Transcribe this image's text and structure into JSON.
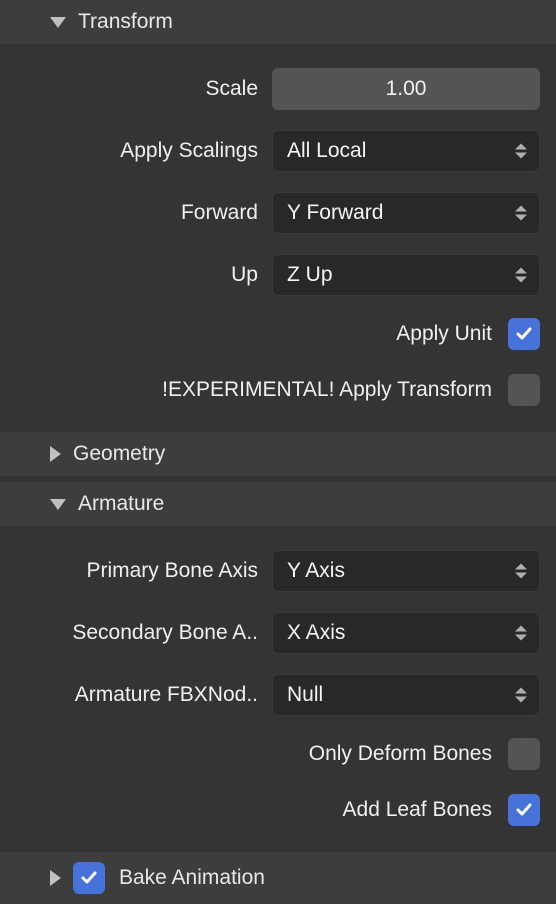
{
  "transform": {
    "header": "Transform",
    "scale_label": "Scale",
    "scale_value": "1.00",
    "apply_scalings_label": "Apply Scalings",
    "apply_scalings_value": "All Local",
    "forward_label": "Forward",
    "forward_value": "Y Forward",
    "up_label": "Up",
    "up_value": "Z Up",
    "apply_unit_label": "Apply Unit",
    "apply_unit_checked": true,
    "experimental_label": "!EXPERIMENTAL! Apply Transform",
    "experimental_checked": false
  },
  "geometry": {
    "header": "Geometry"
  },
  "armature": {
    "header": "Armature",
    "primary_label": "Primary Bone Axis",
    "primary_value": "Y Axis",
    "secondary_label": "Secondary Bone A..",
    "secondary_value": "X Axis",
    "fbxnode_label": "Armature FBXNod..",
    "fbxnode_value": "Null",
    "only_deform_label": "Only Deform Bones",
    "only_deform_checked": false,
    "add_leaf_label": "Add Leaf Bones",
    "add_leaf_checked": true
  },
  "bake": {
    "header": "Bake Animation",
    "checked": true
  }
}
